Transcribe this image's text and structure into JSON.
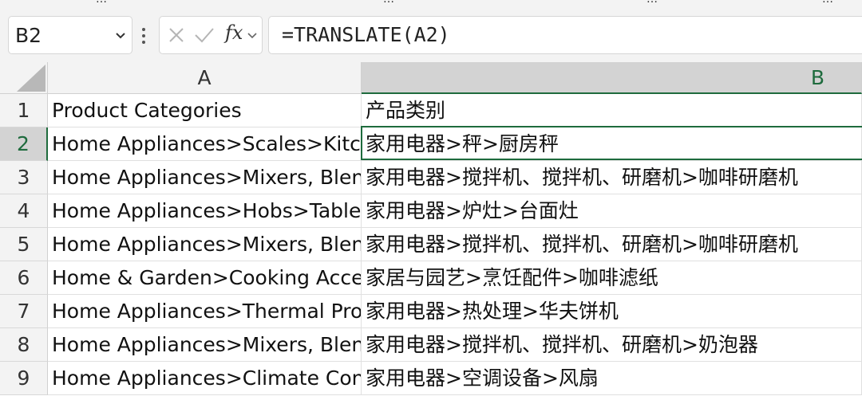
{
  "ribbon_fragments": [
    "…",
    "…",
    "…",
    "…"
  ],
  "name_box": {
    "value": "B2"
  },
  "function_icons": [
    "cancel-icon",
    "enter-icon",
    "fx-icon"
  ],
  "formula_bar": {
    "fx_label": "fx",
    "value": "=TRANSLATE(A2)"
  },
  "columns": [
    {
      "label": "A"
    },
    {
      "label": "B"
    }
  ],
  "rows": [
    {
      "num": "1",
      "a": "Product Categories",
      "b": "产品类别"
    },
    {
      "num": "2",
      "a": "Home Appliances>Scales>Kitchen Scales",
      "b": "家用电器>秤>厨房秤"
    },
    {
      "num": "3",
      "a": "Home Appliances>Mixers, Blenders & Grinders>Coffee Grinders",
      "b": "家用电器>搅拌机、搅拌机、研磨机>咖啡研磨机"
    },
    {
      "num": "4",
      "a": "Home Appliances>Hobs>Tabletop Hobs",
      "b": "家用电器>炉灶>台面灶"
    },
    {
      "num": "5",
      "a": "Home Appliances>Mixers, Blenders & Grinders>Coffee Grinders",
      "b": "家用电器>搅拌机、搅拌机、研磨机>咖啡研磨机"
    },
    {
      "num": "6",
      "a": "Home & Garden>Cooking Accessories>Coffee Filters",
      "b": "家居与园艺>烹饪配件>咖啡滤纸"
    },
    {
      "num": "7",
      "a": "Home Appliances>Thermal Processing>Waffle Makers",
      "b": "家用电器>热处理>华夫饼机"
    },
    {
      "num": "8",
      "a": "Home Appliances>Mixers, Blenders & Grinders>Milk Frothers",
      "b": "家用电器>搅拌机、搅拌机、研磨机>奶泡器"
    },
    {
      "num": "9",
      "a": "Home Appliances>Climate Control>Fans",
      "b": "家用电器>空调设备>风扇"
    }
  ],
  "selection": {
    "cell": "B2"
  },
  "colors": {
    "accent": "#1e6b3d",
    "header_bg": "#f3f3f3",
    "selected_header_bg": "#d3d3d3"
  }
}
